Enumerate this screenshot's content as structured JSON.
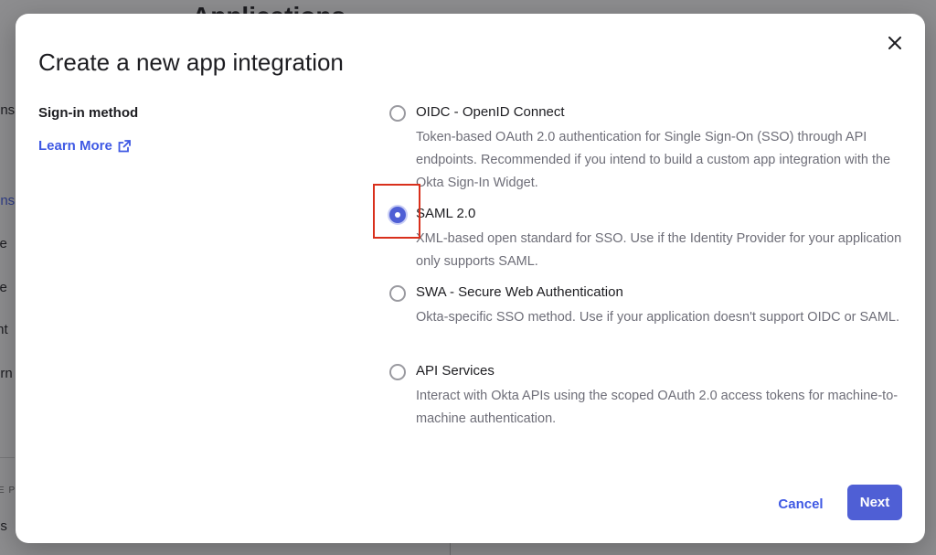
{
  "background": {
    "heading": "Applications",
    "sidebar_fragments": [
      "ons",
      "ons",
      "ce",
      "ce",
      "Int",
      "ern"
    ],
    "caps_text": "E PL",
    "bottom_fragment": "us"
  },
  "modal": {
    "title": "Create a new app integration",
    "section_label": "Sign-in method",
    "learn_more_label": "Learn More",
    "options": [
      {
        "title": "OIDC - OpenID Connect",
        "description": "Token-based OAuth 2.0 authentication for Single Sign-On (SSO) through API endpoints. Recommended if you intend to build a custom app integration with the Okta Sign-In Widget.",
        "selected": false
      },
      {
        "title": "SAML 2.0",
        "description": "XML-based open standard for SSO. Use if the Identity Provider for your application only supports SAML.",
        "selected": true
      },
      {
        "title": "SWA - Secure Web Authentication",
        "description": "Okta-specific SSO method. Use if your application doesn't support OIDC or SAML.",
        "selected": false
      },
      {
        "title": "API Services",
        "description": "Interact with Okta APIs using the scoped OAuth 2.0 access tokens for machine-to-machine authentication.",
        "selected": false
      }
    ],
    "cancel_label": "Cancel",
    "next_label": "Next"
  },
  "icons": {
    "close": "close-icon",
    "external_link": "external-link-icon",
    "radio": "radio-icon"
  },
  "colors": {
    "accent": "#4f5fd5",
    "link": "#3f59e4",
    "highlight": "#d9301c",
    "text_primary": "#1d1d21",
    "text_secondary": "#6e6e78"
  }
}
